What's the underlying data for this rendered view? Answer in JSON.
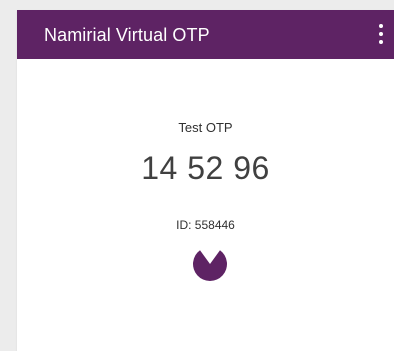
{
  "app_bar": {
    "title": "Namirial Virtual OTP",
    "menu_icon": "more-vert-icon",
    "color": "#5e2364"
  },
  "otp": {
    "name": "Test OTP",
    "code": "14 52 96",
    "id_text": "ID: 558446",
    "timer_icon": "countdown-pie-icon",
    "timer_remaining_fraction": 0.8,
    "timer_color": "#5e2364"
  }
}
